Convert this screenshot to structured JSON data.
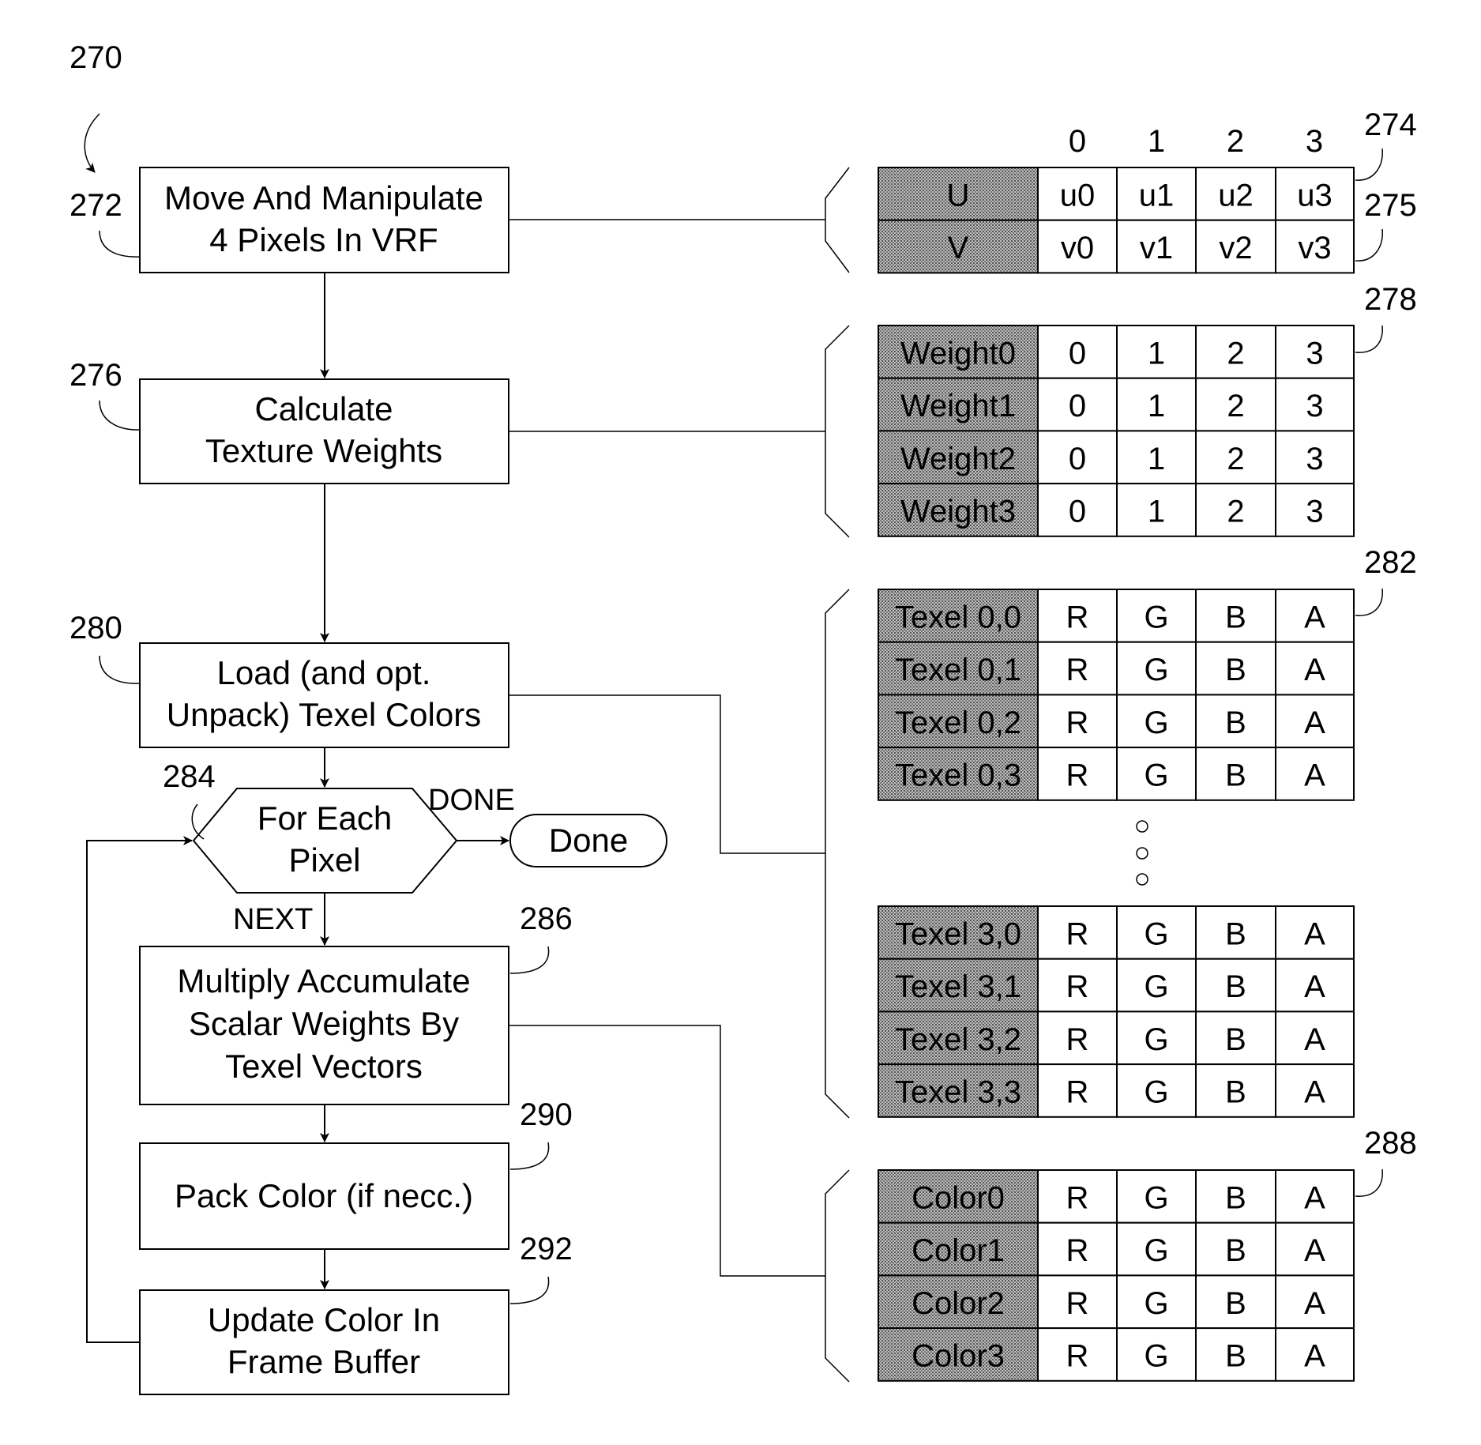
{
  "figure_ref": "270",
  "steps": [
    {
      "ref": "272",
      "lines": [
        "Move And Manipulate",
        "4 Pixels In VRF"
      ]
    },
    {
      "ref": "276",
      "lines": [
        "Calculate",
        "Texture Weights"
      ]
    },
    {
      "ref": "280",
      "lines": [
        "Load (and opt.",
        "Unpack) Texel Colors"
      ]
    },
    {
      "ref": "284",
      "lines": [
        "For Each",
        "Pixel"
      ]
    },
    {
      "ref": "286",
      "lines": [
        "Multiply Accumulate",
        "Scalar Weights By",
        "Texel Vectors"
      ]
    },
    {
      "ref": "290",
      "lines": [
        "Pack Color (if necc.)"
      ]
    },
    {
      "ref": "292",
      "lines": [
        "Update Color In",
        "Frame Buffer"
      ]
    }
  ],
  "terminal": {
    "label": "Done"
  },
  "edge_labels": {
    "done": "DONE",
    "next": "NEXT"
  },
  "uv_table": {
    "refs": [
      "274",
      "275"
    ],
    "column_headers": [
      "0",
      "1",
      "2",
      "3"
    ],
    "rows": [
      {
        "label": "U",
        "cells": [
          "u0",
          "u1",
          "u2",
          "u3"
        ]
      },
      {
        "label": "V",
        "cells": [
          "v0",
          "v1",
          "v2",
          "v3"
        ]
      }
    ]
  },
  "weights_table": {
    "ref": "278",
    "rows": [
      {
        "label": "Weight0",
        "cells": [
          "0",
          "1",
          "2",
          "3"
        ]
      },
      {
        "label": "Weight1",
        "cells": [
          "0",
          "1",
          "2",
          "3"
        ]
      },
      {
        "label": "Weight2",
        "cells": [
          "0",
          "1",
          "2",
          "3"
        ]
      },
      {
        "label": "Weight3",
        "cells": [
          "0",
          "1",
          "2",
          "3"
        ]
      }
    ]
  },
  "texel_table_top": {
    "ref": "282",
    "rows": [
      {
        "label": "Texel 0,0",
        "cells": [
          "R",
          "G",
          "B",
          "A"
        ]
      },
      {
        "label": "Texel 0,1",
        "cells": [
          "R",
          "G",
          "B",
          "A"
        ]
      },
      {
        "label": "Texel 0,2",
        "cells": [
          "R",
          "G",
          "B",
          "A"
        ]
      },
      {
        "label": "Texel 0,3",
        "cells": [
          "R",
          "G",
          "B",
          "A"
        ]
      }
    ]
  },
  "texel_table_bottom": {
    "rows": [
      {
        "label": "Texel 3,0",
        "cells": [
          "R",
          "G",
          "B",
          "A"
        ]
      },
      {
        "label": "Texel 3,1",
        "cells": [
          "R",
          "G",
          "B",
          "A"
        ]
      },
      {
        "label": "Texel 3,2",
        "cells": [
          "R",
          "G",
          "B",
          "A"
        ]
      },
      {
        "label": "Texel 3,3",
        "cells": [
          "R",
          "G",
          "B",
          "A"
        ]
      }
    ]
  },
  "color_table": {
    "ref": "288",
    "rows": [
      {
        "label": "Color0",
        "cells": [
          "R",
          "G",
          "B",
          "A"
        ]
      },
      {
        "label": "Color1",
        "cells": [
          "R",
          "G",
          "B",
          "A"
        ]
      },
      {
        "label": "Color2",
        "cells": [
          "R",
          "G",
          "B",
          "A"
        ]
      },
      {
        "label": "Color3",
        "cells": [
          "R",
          "G",
          "B",
          "A"
        ]
      }
    ]
  },
  "ellipsis_icon": "vertical-circles"
}
